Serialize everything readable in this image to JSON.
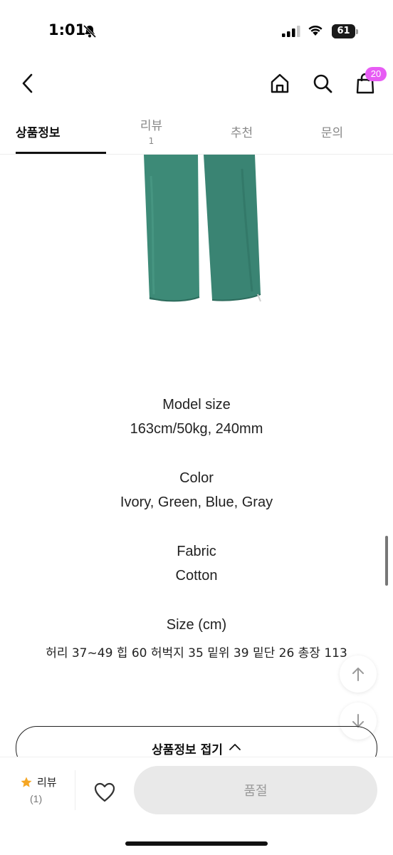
{
  "status_bar": {
    "time": "1:01",
    "battery_text": "61",
    "battery_level_percent": 61,
    "icons": [
      "bell-off-icon",
      "signal-icon",
      "wifi-icon",
      "battery-icon"
    ]
  },
  "header": {
    "icons": [
      "back-chevron-icon",
      "home-icon",
      "search-icon",
      "shopping-bag-icon"
    ],
    "cart_badge": "20"
  },
  "tabs": [
    {
      "label": "상품정보",
      "count": "",
      "active": true
    },
    {
      "label": "리뷰",
      "count": "1",
      "active": false
    },
    {
      "label": "추천",
      "count": "",
      "active": false
    },
    {
      "label": "문의",
      "count": "",
      "active": false
    }
  ],
  "product_info": {
    "model_size_title": "Model size",
    "model_size_value": "163cm/50kg, 240mm",
    "color_title": "Color",
    "color_value": "Ivory, Green, Blue, Gray",
    "fabric_title": "Fabric",
    "fabric_value": "Cotton",
    "size_title": "Size (cm)",
    "size_value": "허리 37~49 힙 60 허벅지 35 밑위 39 밑단 26 총장 113"
  },
  "floating_buttons": {
    "icons": [
      "arrow-up-icon",
      "arrow-down-icon"
    ]
  },
  "collapse_button": {
    "label": "상품정보 접기",
    "icon": "chevron-up-icon"
  },
  "bottom_bar": {
    "review_label": "리뷰",
    "review_count": "(1)",
    "wishlist_icon": "heart-icon",
    "soldout_label": "품절"
  },
  "colors": {
    "badge": "#e75cf4",
    "star": "#f5a623",
    "pants_green": "#3d8a77",
    "soldout_bg": "#e9e9e9"
  }
}
